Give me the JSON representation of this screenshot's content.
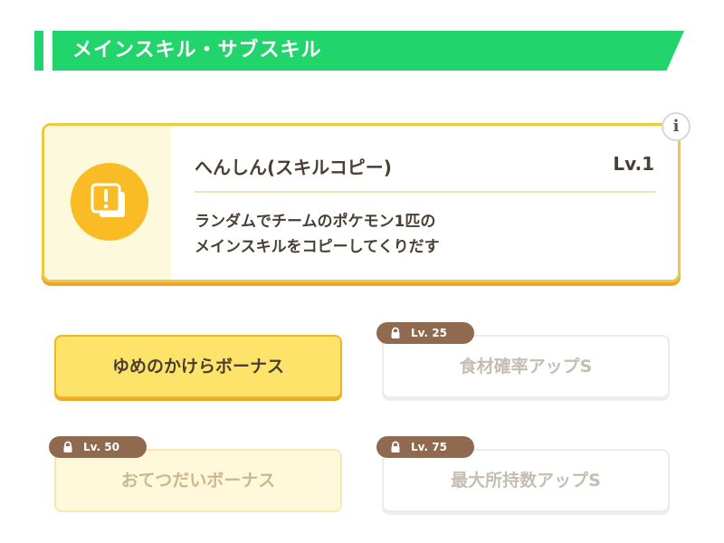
{
  "header": {
    "title": "メインスキル・サブスキル"
  },
  "main_skill": {
    "icon": "exclamation-cards-icon",
    "name": "へんしん(スキルコピー)",
    "level": "Lv.1",
    "description_line1": "ランダムでチームのポケモン1匹の",
    "description_line2": "メインスキルをコピーしてくりだす",
    "info_icon": "i"
  },
  "sub_skills": [
    {
      "label": "ゆめのかけらボーナス",
      "locked": false
    },
    {
      "label": "食材確率アップS",
      "locked": true,
      "unlock": "Lv. 25"
    },
    {
      "label": "おてつだいボーナス",
      "locked": true,
      "unlock": "Lv. 50"
    },
    {
      "label": "最大所持数アップS",
      "locked": true,
      "unlock": "Lv. 75"
    }
  ],
  "colors": {
    "header_green": "#22d46c",
    "card_border": "#f0c642",
    "icon_yellow": "#f9bc25",
    "lock_tag_brown": "#8f6a4f"
  }
}
